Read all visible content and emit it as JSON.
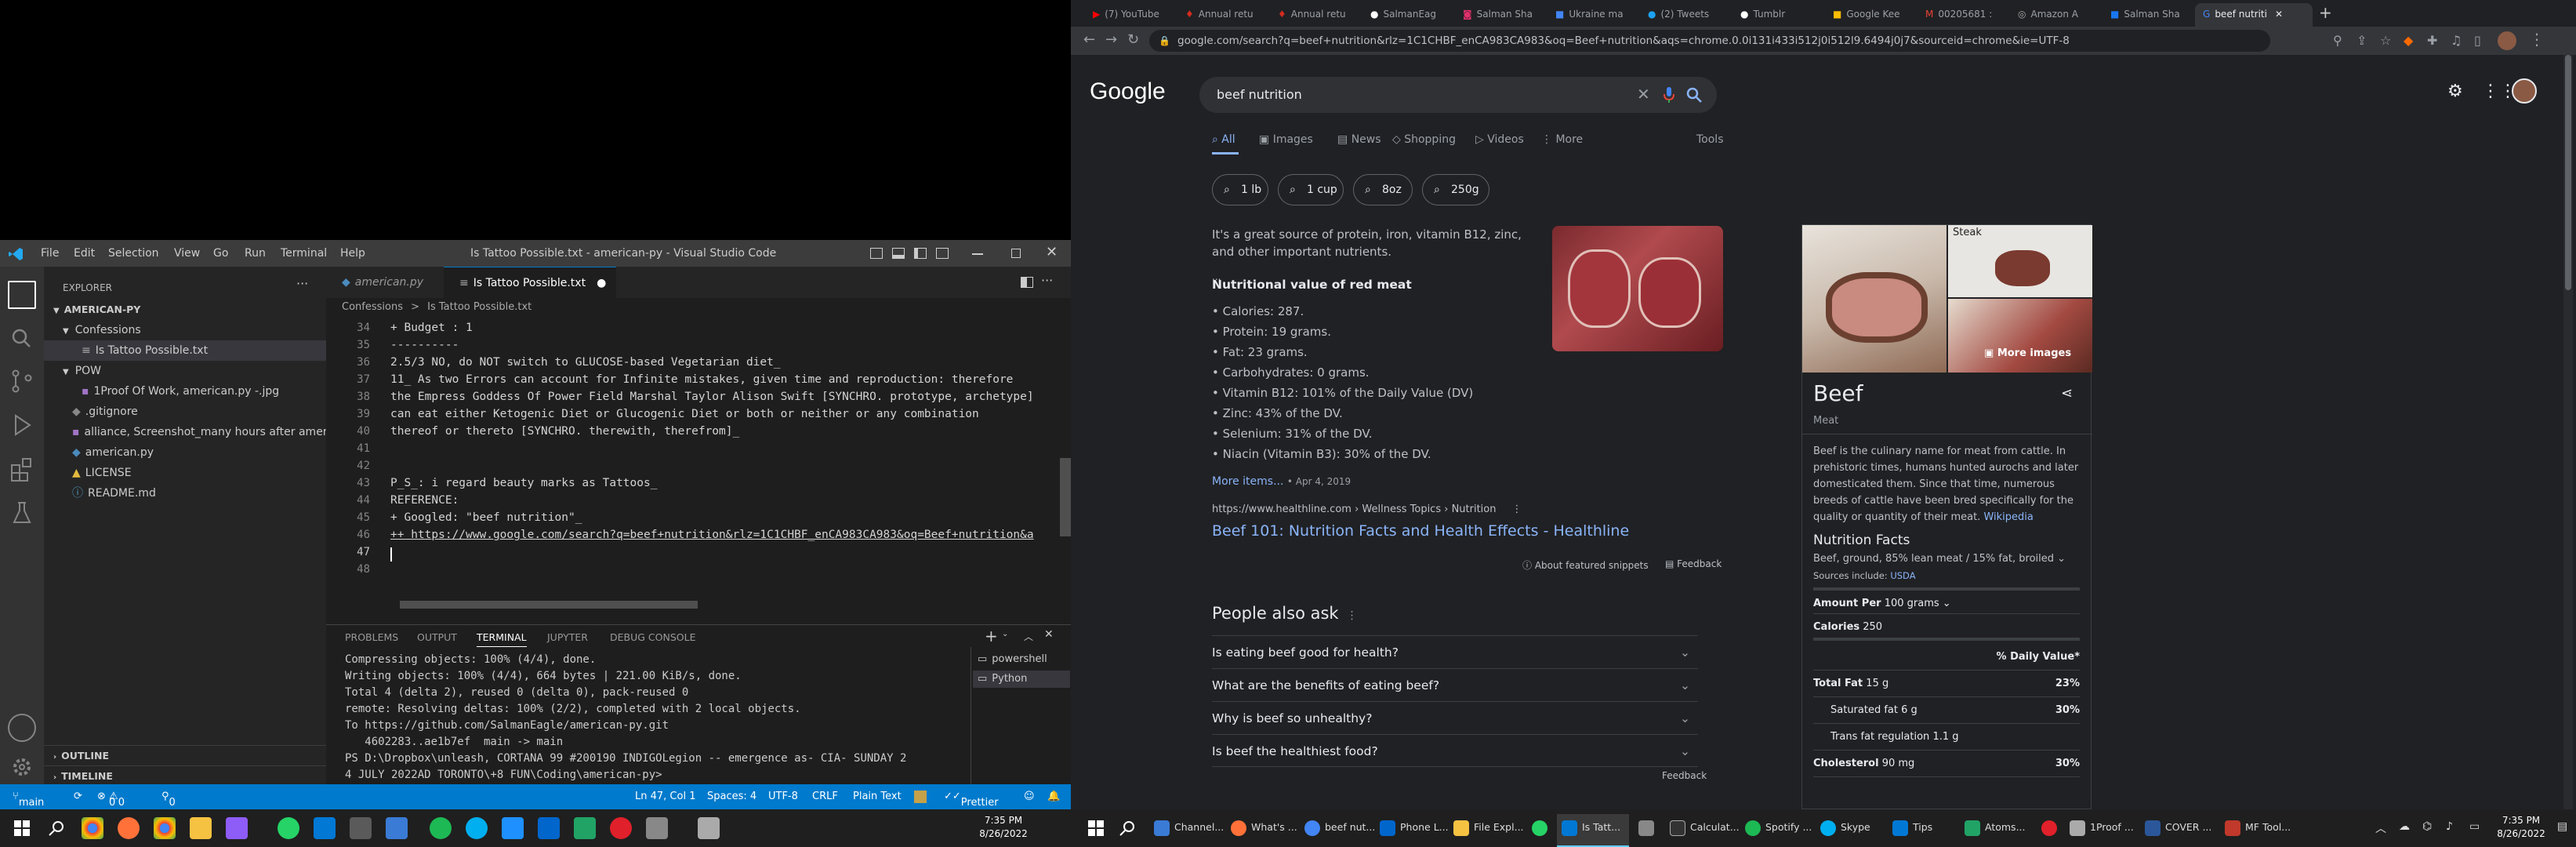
{
  "vscode": {
    "menu": [
      "File",
      "Edit",
      "Selection",
      "View",
      "Go",
      "Run",
      "Terminal",
      "Help"
    ],
    "window_title": "Is Tattoo Possible.txt - american-py - Visual Studio Code",
    "explorer_label": "EXPLORER",
    "project": "AMERICAN-PY",
    "tree": [
      {
        "label": "Confessions",
        "type": "folder"
      },
      {
        "label": "Is Tattoo Possible.txt",
        "type": "file"
      },
      {
        "label": "POW",
        "type": "folder"
      },
      {
        "label": "1Proof Of Work, american.py -.jpg",
        "type": "file"
      },
      {
        "label": ".gitignore",
        "type": "file"
      },
      {
        "label": "alliance, Screenshot_many hours after ameri...",
        "type": "file"
      },
      {
        "label": "american.py",
        "type": "file"
      },
      {
        "label": "LICENSE",
        "type": "file"
      },
      {
        "label": "README.md",
        "type": "file"
      }
    ],
    "outline": "OUTLINE",
    "timeline": "TIMELINE",
    "tabs": [
      {
        "label": "american.py"
      },
      {
        "label": "Is Tattoo Possible.txt"
      }
    ],
    "breadcrumb": [
      "Confessions",
      ">",
      "Is Tattoo Possible.txt"
    ],
    "code_lines": [
      {
        "n": "34",
        "t": "+ Budget : 1"
      },
      {
        "n": "35",
        "t": "----------"
      },
      {
        "n": "36",
        "t": "2.5/3 NO, do NOT switch to GLUCOSE-based Vegetarian diet_"
      },
      {
        "n": "37",
        "t": "11_ As two Errors can account for Infinite mistakes, given time and reproduction: therefore"
      },
      {
        "n": "38",
        "t": "the Empress Goddess Of Power Field Marshal Taylor Alison Swift [SYNCHRO. prototype, archetype]"
      },
      {
        "n": "39",
        "t": "can eat either Ketogenic Diet or Glucogenic Diet or both or neither or any combination"
      },
      {
        "n": "40",
        "t": "thereof or thereto [SYNCHRO. therewith, therefrom]_"
      },
      {
        "n": "41",
        "t": ""
      },
      {
        "n": "42",
        "t": ""
      },
      {
        "n": "43",
        "t": "P_S_: i regard beauty marks as Tattoos_"
      },
      {
        "n": "44",
        "t": "REFERENCE:"
      },
      {
        "n": "45",
        "t": "+ Googled: \"beef nutrition\"_"
      },
      {
        "n": "46",
        "t": "++ https://www.google.com/search?q=beef+nutrition&rlz=1C1CHBF_enCA983CA983&oq=Beef+nutrition&a"
      },
      {
        "n": "47",
        "t": ""
      },
      {
        "n": "48",
        "t": ""
      }
    ],
    "panel_tabs": [
      "PROBLEMS",
      "OUTPUT",
      "TERMINAL",
      "JUPYTER",
      "DEBUG CONSOLE"
    ],
    "terminal_lines": [
      "Compressing objects: 100% (4/4), done.",
      "Writing objects: 100% (4/4), 664 bytes | 221.00 KiB/s, done.",
      "Total 4 (delta 2), reused 0 (delta 0), pack-reused 0",
      "remote: Resolving deltas: 100% (2/2), completed with 2 local objects.",
      "To https://github.com/SalmanEagle/american-py.git",
      "   4602283..ae1b7ef  main -> main",
      "PS D:\\Dropbox\\unleash, CORTANA 99 #200190 INDIGOLegion -- emergence as- CIA- SUNDAY 2",
      "4 JULY 2022AD TORONTO\\+8 FUN\\Coding\\american-py> "
    ],
    "terminals": [
      "powershell",
      "Python"
    ],
    "status": {
      "branch": "main",
      "errors": "0",
      "warnings": "0",
      "ports": "0",
      "position": "Ln 47, Col 1",
      "spaces": "Spaces: 4",
      "encoding": "UTF-8",
      "eol": "CRLF",
      "language": "Plain Text",
      "prettier": "Prettier"
    }
  },
  "chrome": {
    "tabs": [
      "(7) YouTube",
      "Annual retu",
      "Annual retu",
      "SalmanEag",
      "Salman Sha",
      "Ukraine ma",
      "(2) Tweets",
      "Tumblr",
      "Google Kee",
      "00205681 :",
      "Amazon A",
      "Salman Sha",
      "beef nutriti"
    ],
    "url": "google.com/search?q=beef+nutrition&rlz=1C1CHBF_enCA983CA983&oq=Beef+nutrition&aqs=chrome.0.0i131i433i512j0i512l9.6494j0j7&sourceid=chrome&ie=UTF-8",
    "logo": "Google",
    "query": "beef nutrition",
    "search_tabs": [
      "All",
      "Images",
      "News",
      "Shopping",
      "Videos",
      "More"
    ],
    "tools": "Tools",
    "chips": [
      "1 lb",
      "1 cup",
      "8oz",
      "250g"
    ],
    "snippet_intro": "It's a great source of protein, iron, vitamin B12, zinc, and other important nutrients.",
    "snippet_heading": "Nutritional value of red meat",
    "snippet_items": [
      "Calories: 287.",
      "Protein: 19 grams.",
      "Fat: 23 grams.",
      "Carbohydrates: 0 grams.",
      "Vitamin B12: 101% of the Daily Value (DV)",
      "Zinc: 43% of the DV.",
      "Selenium: 31% of the DV.",
      "Niacin (Vitamin B3): 30% of the DV."
    ],
    "more_items": "More items...",
    "date": "• Apr 4, 2019",
    "source_url": "https://www.healthline.com › Wellness Topics › Nutrition",
    "result_title": "Beef 101: Nutrition Facts and Health Effects - Healthline",
    "about_snippets": "About featured snippets",
    "feedback": "Feedback",
    "paa_title": "People also ask",
    "paa": [
      "Is eating beef good for health?",
      "What are the benefits of eating beef?",
      "Why is beef so unhealthy?",
      "Is beef the healthiest food?"
    ],
    "kp": {
      "img_label": "Steak",
      "more_images": "More images",
      "title": "Beef",
      "subtitle": "Meat",
      "description": "Beef is the culinary name for meat from cattle. In prehistoric times, humans hunted aurochs and later domesticated them. Since that time, numerous breeds of cattle have been bred specifically for the quality or quantity of their meat.",
      "wiki": "Wikipedia",
      "nf_title": "Nutrition Facts",
      "nf_food": "Beef, ground, 85% lean meat / 15% fat, broiled",
      "sources": "Sources include:",
      "usda": "USDA",
      "amount": "Amount Per",
      "amount_val": "100 grams",
      "calories_label": "Calories",
      "calories": "250",
      "dv_header": "% Daily Value*",
      "rows": [
        {
          "label": "Total Fat",
          "val": "15 g",
          "dv": "23%",
          "indent": false
        },
        {
          "label": "Saturated fat",
          "val": "6 g",
          "dv": "30%",
          "indent": true
        },
        {
          "label": "Trans fat regulation",
          "val": "1.1 g",
          "dv": "",
          "indent": true
        },
        {
          "label": "Cholesterol",
          "val": "90 mg",
          "dv": "30%",
          "indent": false
        }
      ]
    }
  },
  "taskbar": {
    "items": [
      "Channel...",
      "What's ...",
      "beef nut...",
      "Phone L...",
      "File Expl...",
      "Is Tatt...",
      "Calculat...",
      "Spotify ...",
      "Skype",
      "Tips",
      "Atoms...",
      "1Proof ...",
      "COVER ...",
      "MF Tool..."
    ],
    "time_left": "7:35 PM",
    "date_left": "8/26/2022",
    "time_right": "7:35 PM",
    "date_right": "8/26/2022"
  }
}
